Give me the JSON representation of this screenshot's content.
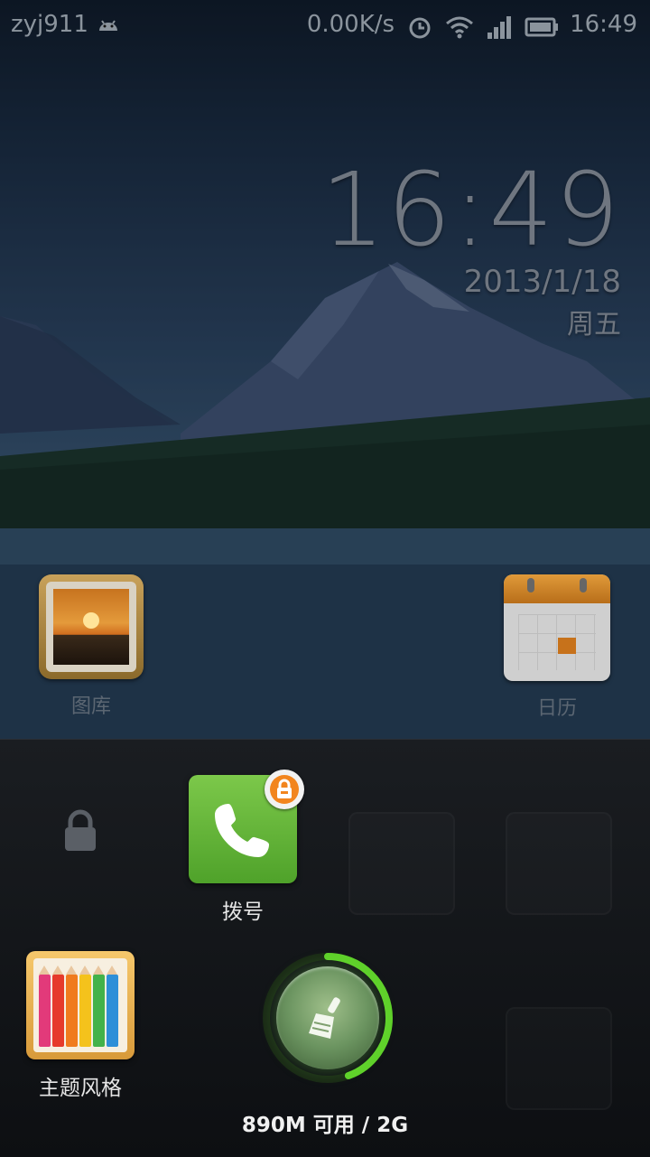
{
  "status_bar": {
    "user": "zyj911",
    "speed": "0.00K/s",
    "time": "16:49"
  },
  "clock_widget": {
    "time": "16:49",
    "date": "2013/1/18",
    "weekday": "周五"
  },
  "desktop_icons": [
    {
      "label": "图库",
      "icon": "gallery-icon"
    },
    {
      "label": "日历",
      "icon": "calendar-icon"
    }
  ],
  "task_panel": {
    "apps": [
      {
        "label": "拨号",
        "icon": "dialer-icon",
        "locked": true
      },
      {
        "label": "主题风格",
        "icon": "themes-icon"
      }
    ],
    "memory": {
      "text": "890M 可用 / 2G",
      "free_fraction": 0.445
    }
  },
  "colors": {
    "accent_green": "#5fd12a",
    "lock_badge": "#f2851e"
  }
}
